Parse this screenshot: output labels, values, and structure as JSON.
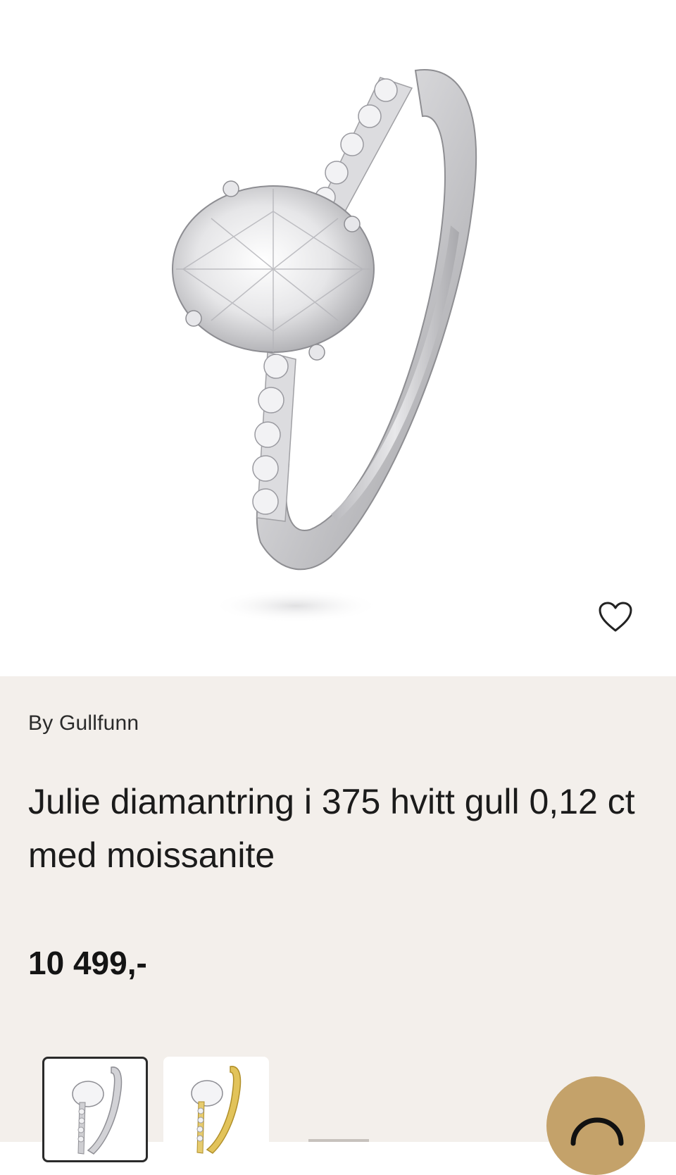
{
  "product": {
    "brand": "By Gullfunn",
    "title": "Julie diamantring i 375 hvitt gull 0,12 ct med moissanite",
    "price": "10 499,-"
  },
  "icons": {
    "wishlist": "heart-outline-icon",
    "chat": "chat-bubble-icon"
  },
  "variants": [
    {
      "name": "hvitt gull",
      "selected": true
    },
    {
      "name": "gult gull",
      "selected": false
    }
  ],
  "colors": {
    "info_background": "#f3efeb",
    "chat_button": "#c4a26a",
    "text": "#1a1a1a"
  }
}
